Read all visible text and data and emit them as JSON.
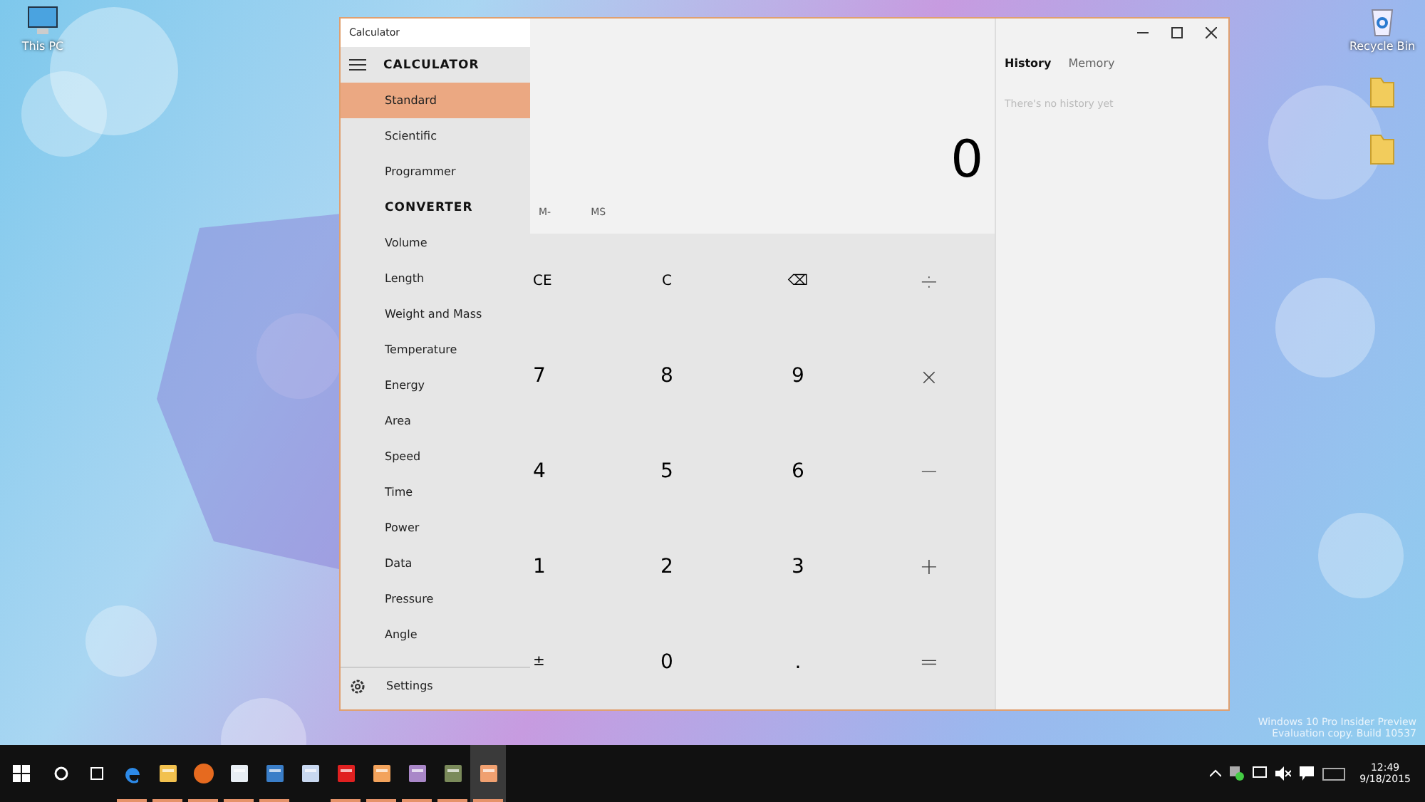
{
  "desktop": {
    "icons": [
      {
        "kind": "computer",
        "label": "This PC"
      },
      {
        "kind": "recycle-bin",
        "label": "Recycle Bin"
      },
      {
        "kind": "folder"
      },
      {
        "kind": "folder"
      }
    ],
    "watermark_lines": [
      "Windows 10 Pro Insider Preview",
      "Evaluation copy. Build 10537"
    ]
  },
  "window": {
    "title": "Calculator",
    "nav": {
      "sections": [
        {
          "heading": "CALCULATOR",
          "items": [
            {
              "label": "Standard",
              "selected": true
            },
            {
              "label": "Scientific",
              "selected": false
            },
            {
              "label": "Programmer",
              "selected": false
            }
          ]
        },
        {
          "heading": "CONVERTER",
          "items": [
            {
              "label": "Volume",
              "selected": false
            },
            {
              "label": "Length",
              "selected": false
            },
            {
              "label": "Weight and Mass",
              "selected": false
            },
            {
              "label": "Temperature",
              "selected": false
            },
            {
              "label": "Energy",
              "selected": false
            },
            {
              "label": "Area",
              "selected": false
            },
            {
              "label": "Speed",
              "selected": false
            },
            {
              "label": "Time",
              "selected": false
            },
            {
              "label": "Power",
              "selected": false
            },
            {
              "label": "Data",
              "selected": false
            },
            {
              "label": "Pressure",
              "selected": false
            },
            {
              "label": "Angle",
              "selected": false
            }
          ]
        }
      ],
      "settings": "Settings"
    },
    "memory_buttons": [
      "M-",
      "MS"
    ],
    "display": "0",
    "keys": [
      {
        "label": "CE",
        "kind": "fn"
      },
      {
        "label": "C",
        "kind": "fn"
      },
      {
        "label": "⌫",
        "kind": "fn"
      },
      {
        "label": "÷",
        "kind": "op"
      },
      {
        "label": "7",
        "kind": "digit"
      },
      {
        "label": "8",
        "kind": "digit"
      },
      {
        "label": "9",
        "kind": "digit"
      },
      {
        "label": "×",
        "kind": "op"
      },
      {
        "label": "4",
        "kind": "digit"
      },
      {
        "label": "5",
        "kind": "digit"
      },
      {
        "label": "6",
        "kind": "digit"
      },
      {
        "label": "−",
        "kind": "op"
      },
      {
        "label": "1",
        "kind": "digit"
      },
      {
        "label": "2",
        "kind": "digit"
      },
      {
        "label": "3",
        "kind": "digit"
      },
      {
        "label": "+",
        "kind": "op"
      },
      {
        "label": "±",
        "kind": "fn"
      },
      {
        "label": "0",
        "kind": "digit"
      },
      {
        "label": ".",
        "kind": "digit"
      },
      {
        "label": "=",
        "kind": "op"
      }
    ],
    "panel": {
      "tabs": [
        {
          "label": "History",
          "selected": true
        },
        {
          "label": "Memory",
          "selected": false
        }
      ],
      "empty_message": "There's no history yet"
    }
  },
  "taskbar": {
    "apps": [
      {
        "kind": "edge",
        "running": true,
        "selected": false
      },
      {
        "kind": "explorer",
        "running": true,
        "selected": false
      },
      {
        "kind": "firefox",
        "running": true,
        "selected": false
      },
      {
        "kind": "store",
        "running": true,
        "selected": false
      },
      {
        "kind": "mail-app",
        "running": true,
        "selected": false
      },
      {
        "kind": "document",
        "running": false,
        "selected": false
      },
      {
        "kind": "red-app",
        "running": true,
        "selected": false
      },
      {
        "kind": "envelope",
        "running": true,
        "selected": false
      },
      {
        "kind": "purple-app",
        "running": true,
        "selected": false
      },
      {
        "kind": "dark-app",
        "running": true,
        "selected": false
      },
      {
        "kind": "calculator",
        "running": true,
        "selected": true
      }
    ],
    "clock": {
      "time": "12:49",
      "date": "9/18/2015"
    }
  }
}
